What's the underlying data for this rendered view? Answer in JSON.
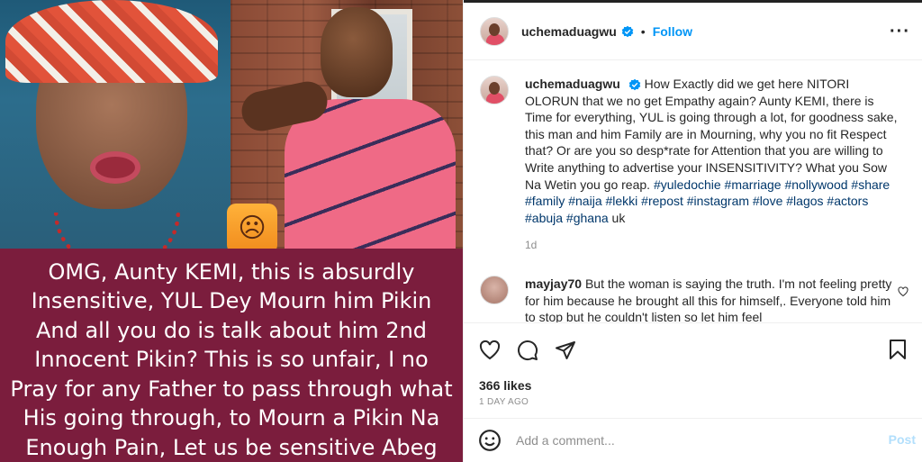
{
  "media": {
    "caption": "OMG, Aunty KEMI, this is absurdly Insensitive, YUL Dey Mourn him Pikin And all you do is talk about him 2nd Innocent Pikin? This is so unfair, I no Pray for any Father to pass through what His going through, to Mourn a Pikin Na Enough Pain, Let us be sensitive Abeg",
    "caption_bg": "#7b1d3d"
  },
  "header": {
    "username": "uchemaduagwu",
    "separator": "•",
    "follow_label": "Follow",
    "more_label": "···"
  },
  "post": {
    "username": "uchemaduagwu",
    "text": "How Exactly did we get here NITORI OLORUN that we no get Empathy again? Aunty KEMI, there is Time for everything, YUL is going through a lot, for goodness sake, this man and him Family are in Mourning, why you no fit Respect that? Or are you so desp*rate for Attention that you are willing to Write anything to advertise your INSENSITIVITY? What you Sow Na Wetin you go reap.",
    "hashtags": "#yuledochie #marriage #nollywood #share #family #naija #lekki #repost #instagram #love #lagos #actors #abuja #ghana",
    "suffix": " uk",
    "time": "1d"
  },
  "comment": {
    "username": "mayjay70",
    "text": "But the woman is saying the truth. I'm not feeling pretty for him because he brought all this for himself,. Everyone told him to stop but he couldn't listen so let him feel"
  },
  "stats": {
    "likes": "366 likes",
    "date": "1 DAY AGO"
  },
  "composer": {
    "placeholder": "Add a comment...",
    "post_label": "Post"
  },
  "colors": {
    "follow": "#0095f6",
    "hashtag": "#00376b",
    "post_disabled": "#b2dffc"
  }
}
